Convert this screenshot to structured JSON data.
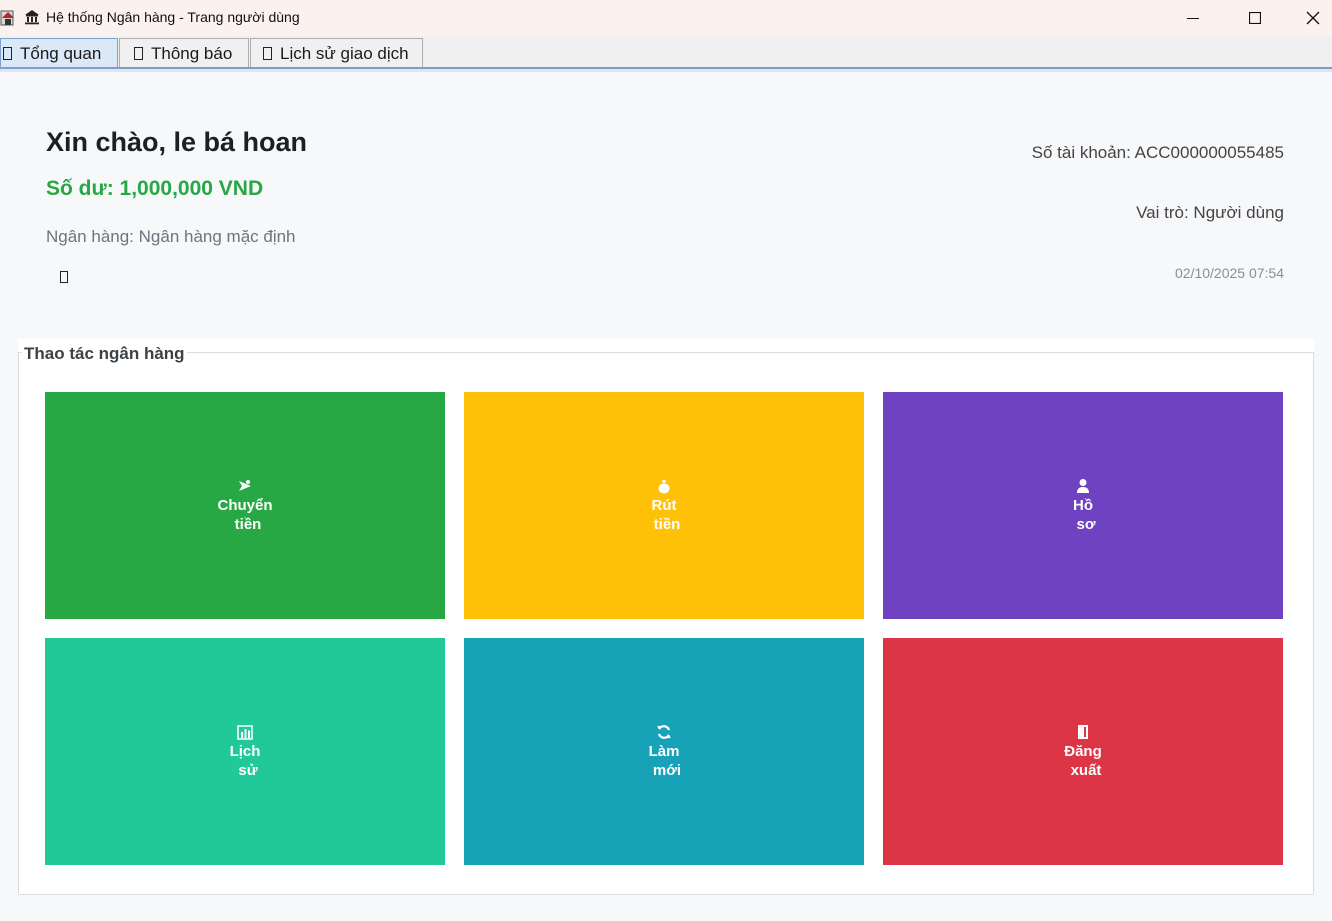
{
  "window": {
    "title": "Hệ thống Ngân hàng - Trang người dùng"
  },
  "tabs": [
    {
      "label": "Tổng quan",
      "active": true
    },
    {
      "label": "Thông báo",
      "active": false
    },
    {
      "label": "Lịch sử giao dịch",
      "active": false
    }
  ],
  "overview": {
    "greeting": "Xin chào, le bá hoan",
    "balance": "Số dư: 1,000,000 VND",
    "bank": "Ngân hàng: Ngân hàng mặc định",
    "account": "Số tài khoản: ACC000000055485",
    "role": "Vai trò: Người dùng",
    "datetime": "02/10/2025 07:54"
  },
  "actions": {
    "title": "Thao tác ngân hàng",
    "buttons": [
      {
        "line1": "Chuyển",
        "line2": "tiền",
        "icon": "send-money-icon",
        "color": "#28a745"
      },
      {
        "line1": "Rút",
        "line2": "tiền",
        "icon": "money-bag-icon",
        "color": "#ffc107"
      },
      {
        "line1": "Hồ",
        "line2": "sơ",
        "icon": "user-icon",
        "color": "#6f42c1"
      },
      {
        "line1": "Lịch",
        "line2": "sử",
        "icon": "bar-chart-icon",
        "color": "#20c997"
      },
      {
        "line1": "Làm",
        "line2": "mới",
        "icon": "refresh-icon",
        "color": "#17a2b8"
      },
      {
        "line1": "Đăng",
        "line2": "xuất",
        "icon": "door-icon",
        "color": "#dc3545"
      }
    ]
  },
  "colors": {
    "accent_green": "#28a745",
    "tab_active_bg": "#dbe8f8"
  }
}
